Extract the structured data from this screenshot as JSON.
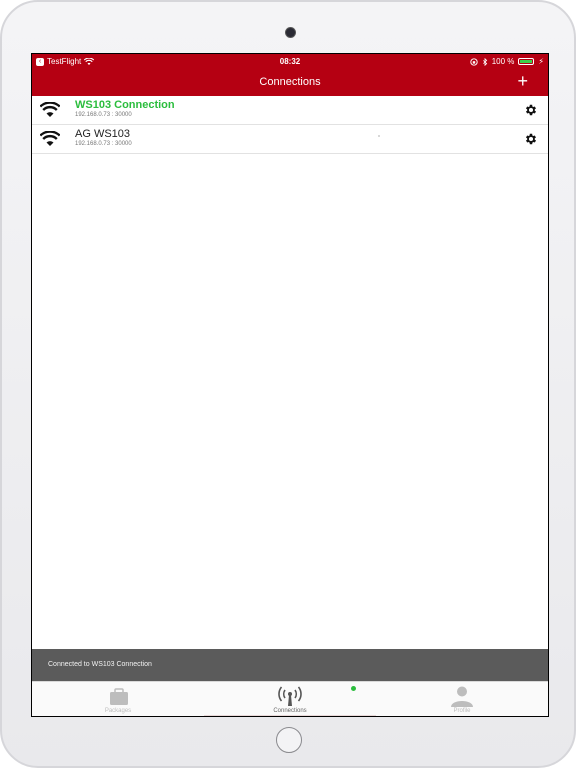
{
  "status_bar": {
    "back_app": "TestFlight",
    "time": "08:32",
    "battery": "100 %"
  },
  "nav": {
    "title": "Connections",
    "add_label": "+"
  },
  "connections": [
    {
      "name": "WS103 Connection",
      "address": "192.168.0.73 : 30000",
      "active": true
    },
    {
      "name": "AG WS103",
      "address": "192.168.0.73 : 30000",
      "active": false
    }
  ],
  "toast": {
    "message": "Connected to WS103 Connection"
  },
  "tabs": [
    {
      "label": "Packages"
    },
    {
      "label": "Connections"
    },
    {
      "label": "Profile"
    }
  ],
  "colors": {
    "brand": "#b50012",
    "active": "#2bbd3d",
    "toast": "#5b5b5b"
  }
}
